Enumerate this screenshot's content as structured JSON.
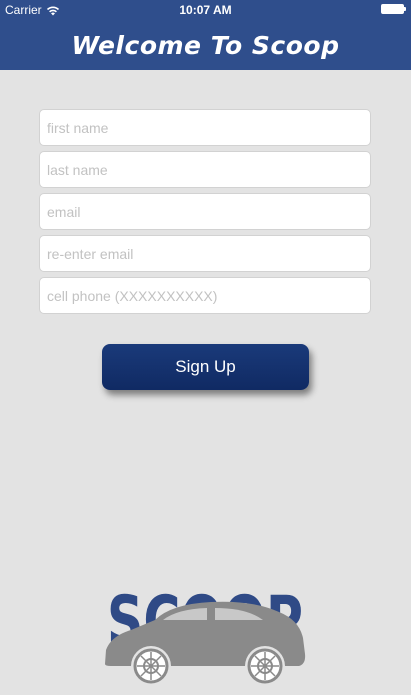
{
  "status_bar": {
    "carrier": "Carrier",
    "time": "10:07 AM"
  },
  "header": {
    "title": "Welcome To Scoop"
  },
  "form": {
    "first_name_placeholder": "first name",
    "last_name_placeholder": "last name",
    "email_placeholder": "email",
    "reenter_email_placeholder": "re-enter email",
    "cell_phone_placeholder": "cell phone (XXXXXXXXXX)"
  },
  "signup_button": {
    "label": "Sign Up"
  },
  "logo": {
    "text": "SCOOP"
  },
  "colors": {
    "header_bg": "#2f4e8c",
    "button_bg": "#1a3a7a",
    "page_bg": "#e3e3e3",
    "logo_text": "#2f4a86",
    "logo_car": "#8a8a8a"
  }
}
